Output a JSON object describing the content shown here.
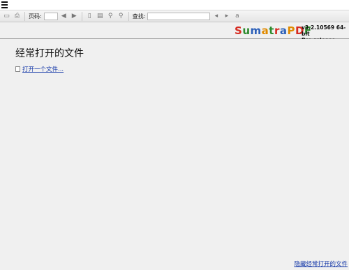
{
  "toolbar": {
    "page_label": "页码:",
    "page_value": "",
    "find_label": "查找:",
    "find_value": "",
    "buttons": [
      "open-icon",
      "print-icon",
      "prev-page-icon",
      "next-page-icon",
      "fit-page-icon",
      "fit-width-icon",
      "zoom-out-icon",
      "zoom-in-icon",
      "find-prev-icon",
      "find-next-icon",
      "match-case-icon"
    ]
  },
  "header": {
    "logo_letters": [
      {
        "ch": "S",
        "color": "#d62b21"
      },
      {
        "ch": "u",
        "color": "#2d8a2d"
      },
      {
        "ch": "m",
        "color": "#2b5fb8"
      },
      {
        "ch": "a",
        "color": "#e08a00"
      },
      {
        "ch": "t",
        "color": "#2d8a2d"
      },
      {
        "ch": "r",
        "color": "#d62b21"
      },
      {
        "ch": "a",
        "color": "#2b5fb8"
      },
      {
        "ch": "P",
        "color": "#e08a00"
      },
      {
        "ch": "D",
        "color": "#d62b21"
      },
      {
        "ch": "F",
        "color": "#2d8a2d"
      }
    ],
    "version_line1": "v3.2.10569 64-bit",
    "version_line2": "Pre-release"
  },
  "main": {
    "title": "经常打开的文件",
    "open_file_link": "打开一个文件...",
    "hide_link": "隐藏经常打开的文件"
  }
}
